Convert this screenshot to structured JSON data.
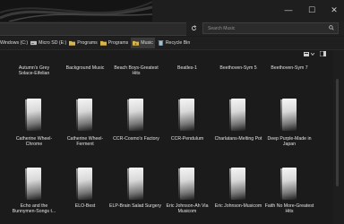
{
  "window": {
    "minimize": "—",
    "maximize": "☐",
    "close": "✕"
  },
  "search": {
    "placeholder": "Search Music"
  },
  "quick_access": [
    {
      "label": "Windows (C:)",
      "type": "drive"
    },
    {
      "label": "Micro SD (E:)",
      "type": "drive"
    },
    {
      "label": "Programs",
      "type": "folder"
    },
    {
      "label": "Programs",
      "type": "folder"
    },
    {
      "label": "Music",
      "type": "folder",
      "active": true
    },
    {
      "label": "Recycle Bin",
      "type": "folder"
    }
  ],
  "row0": [
    "Autumn's Grey Solace-Eifelian",
    "Background Music",
    "Beach Boys-Greatest Hits",
    "Beatles-1",
    "Beethoven-Sym 5",
    "Beethoven-Sym 7"
  ],
  "row1": [
    "Catherine Wheel-Chrome",
    "Catherine Wheel-Ferment",
    "CCR-Cosmo's Factory",
    "CCR-Pendulum",
    "Charlatans-Melting Pot",
    "Deep Purple-Made in Japan"
  ],
  "row2": [
    "Echo and the Bunnymen-Songs t...",
    "ELO-Best",
    "ELP-Brain Salad Surgery",
    "Eric Johnson-Ah Via Musicom",
    "Eric Johnson-Musicom",
    "Faith No More-Greatest Hits"
  ],
  "colors": {
    "background": "#1b1b1b",
    "chrome": "#202020",
    "text": "#e3e3e3"
  }
}
